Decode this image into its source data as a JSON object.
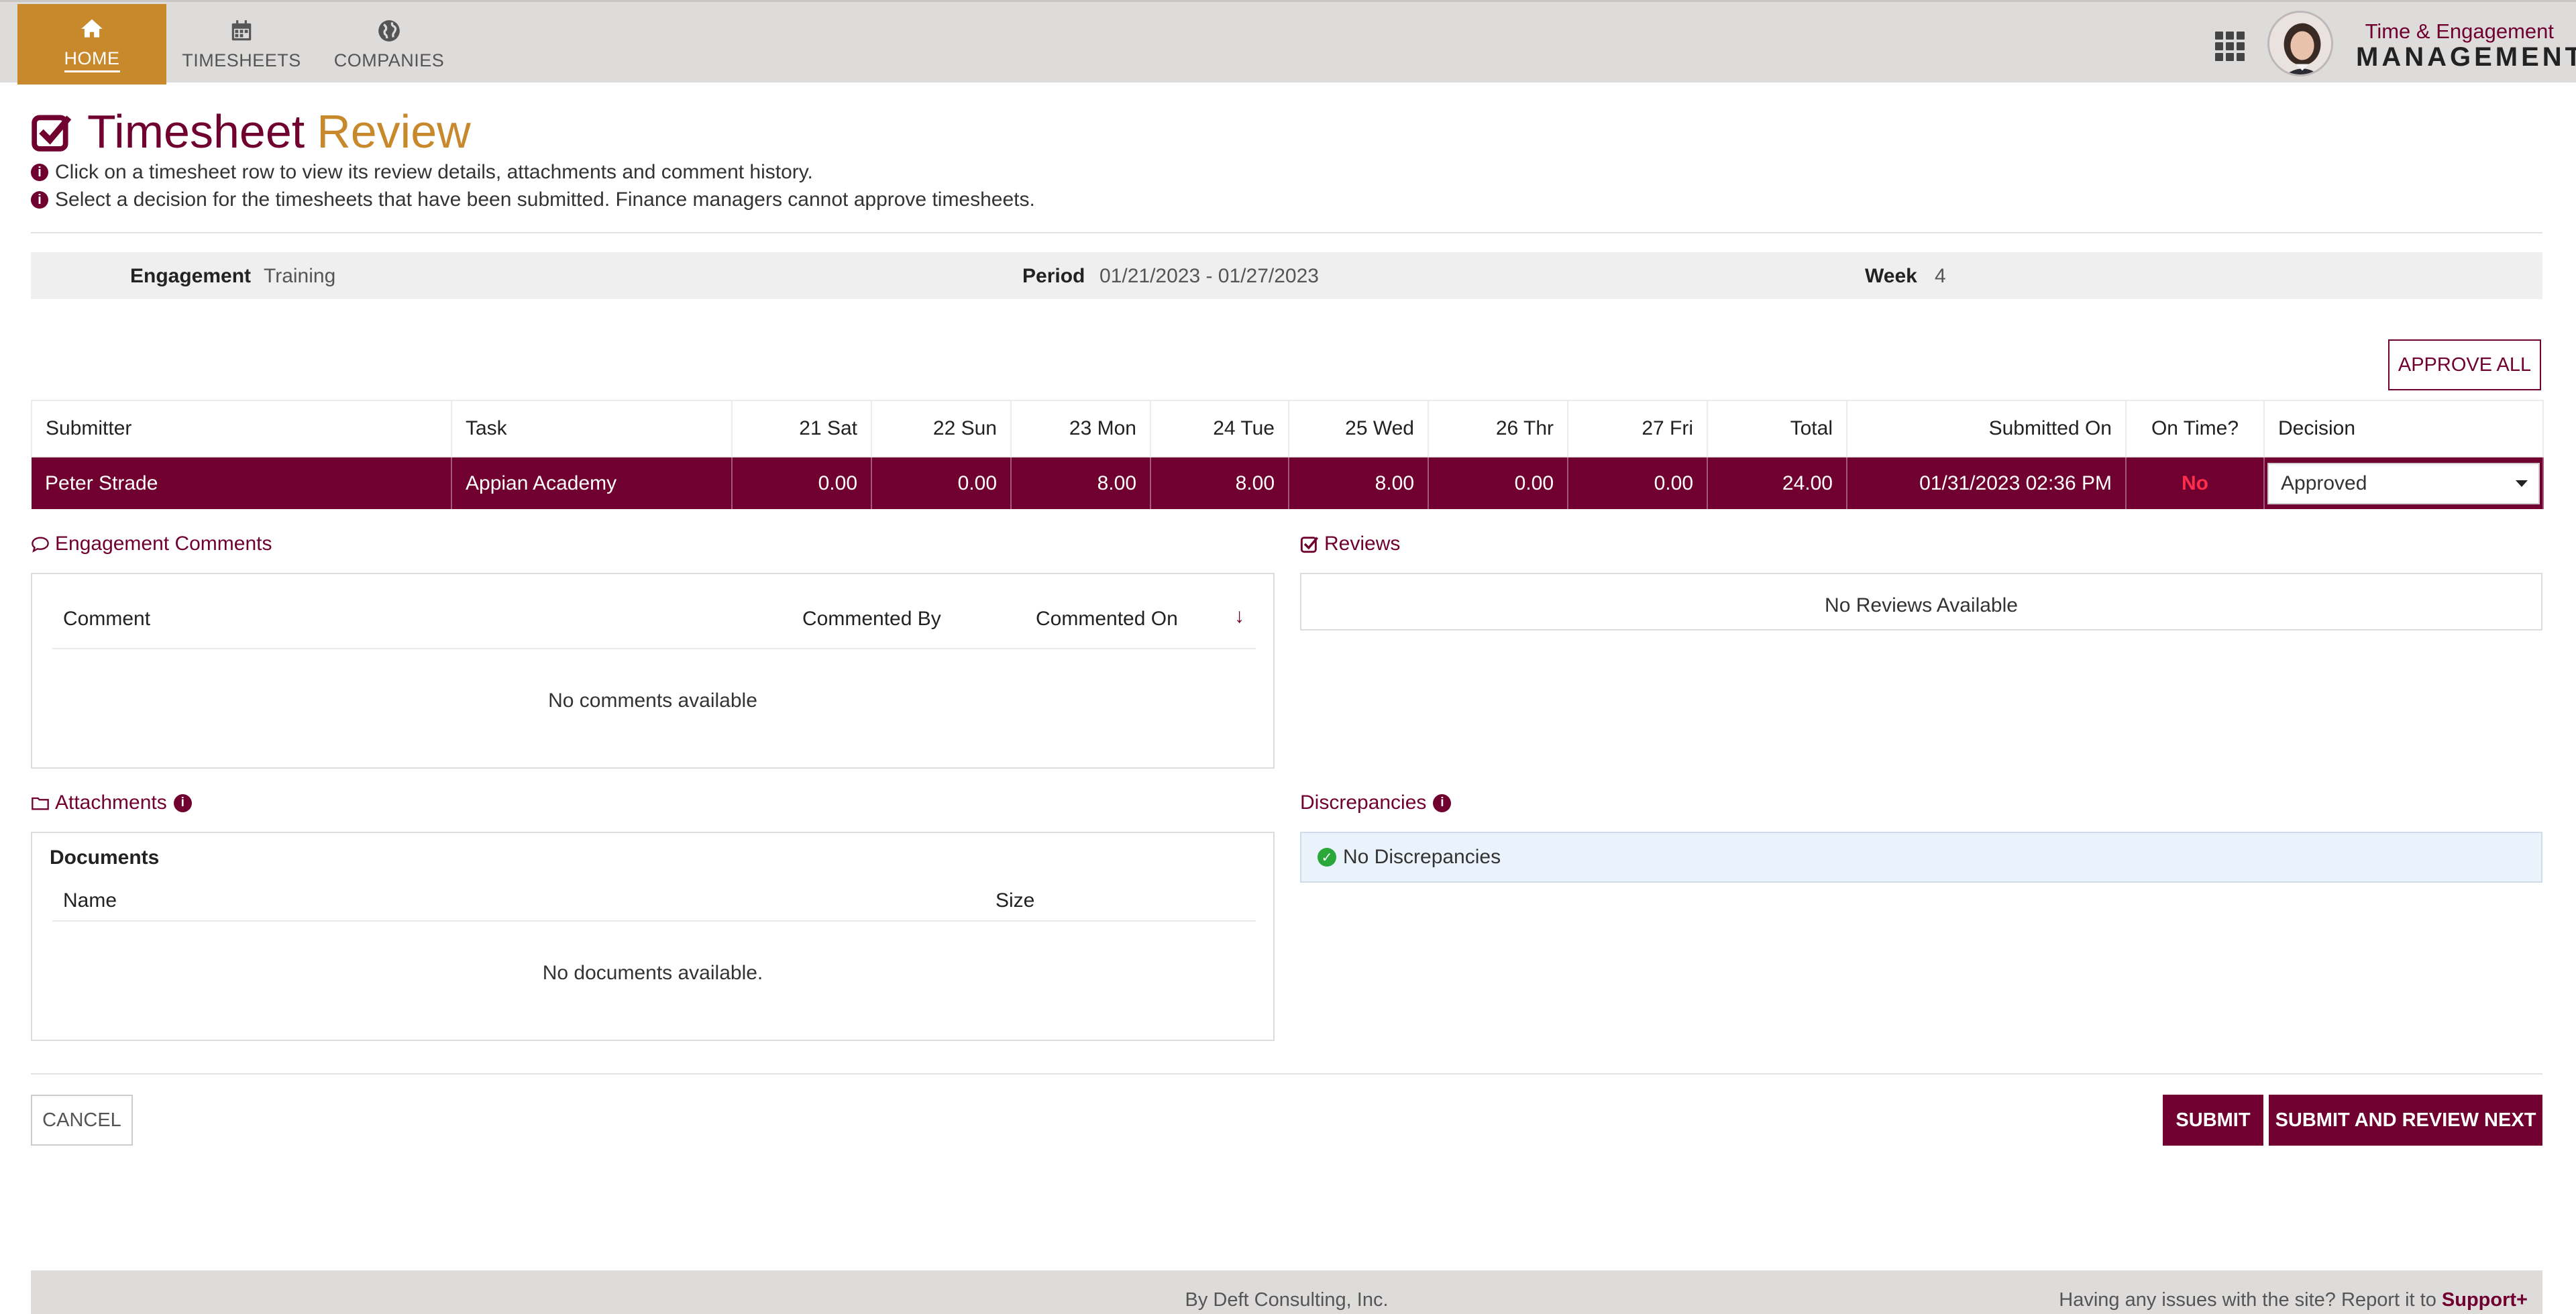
{
  "nav": {
    "home": "HOME",
    "timesheets": "TIMESHEETS",
    "companies": "COMPANIES",
    "brand_top": "Time & Engagement",
    "brand_bottom": "MANAGEMENT"
  },
  "page": {
    "title_part1": "Timesheet",
    "title_part2": "Review",
    "info1": "Click on a timesheet row to view its review details, attachments and comment history.",
    "info2": "Select a decision for the timesheets that have been submitted. Finance managers cannot approve timesheets."
  },
  "summary": {
    "engagement_label": "Engagement",
    "engagement_value": "Training",
    "period_label": "Period",
    "period_value": "01/21/2023 - 01/27/2023",
    "week_label": "Week",
    "week_value": "4"
  },
  "approve_all": "APPROVE ALL",
  "table": {
    "headers": [
      "Submitter",
      "Task",
      "21 Sat",
      "22 Sun",
      "23 Mon",
      "24 Tue",
      "25 Wed",
      "26 Thr",
      "27 Fri",
      "Total",
      "Submitted On",
      "On Time?",
      "Decision"
    ],
    "row": {
      "submitter": "Peter Strade",
      "task": "Appian Academy",
      "days": [
        "0.00",
        "0.00",
        "8.00",
        "8.00",
        "8.00",
        "0.00",
        "0.00"
      ],
      "total": "24.00",
      "submitted_on": "01/31/2023 02:36 PM",
      "on_time": "No",
      "decision": "Approved"
    }
  },
  "comments": {
    "title": "Engagement Comments",
    "col_comment": "Comment",
    "col_by": "Commented By",
    "col_on": "Commented On",
    "empty": "No comments available"
  },
  "reviews": {
    "title": "Reviews",
    "empty": "No Reviews Available"
  },
  "attachments": {
    "title": "Attachments",
    "documents": "Documents",
    "col_name": "Name",
    "col_size": "Size",
    "empty": "No documents available."
  },
  "discrepancies": {
    "title": "Discrepancies",
    "status": "No Discrepancies"
  },
  "actions": {
    "cancel": "CANCEL",
    "submit": "SUBMIT",
    "submit_next": "SUBMIT AND REVIEW NEXT"
  },
  "footer": {
    "center": "By Deft Consulting, Inc.",
    "right_text": "Having any issues with the site? Report it to",
    "right_link": "Support+"
  },
  "colors": {
    "primary": "#70002f",
    "accent": "#c8892c",
    "late": "#ff2e4c"
  }
}
